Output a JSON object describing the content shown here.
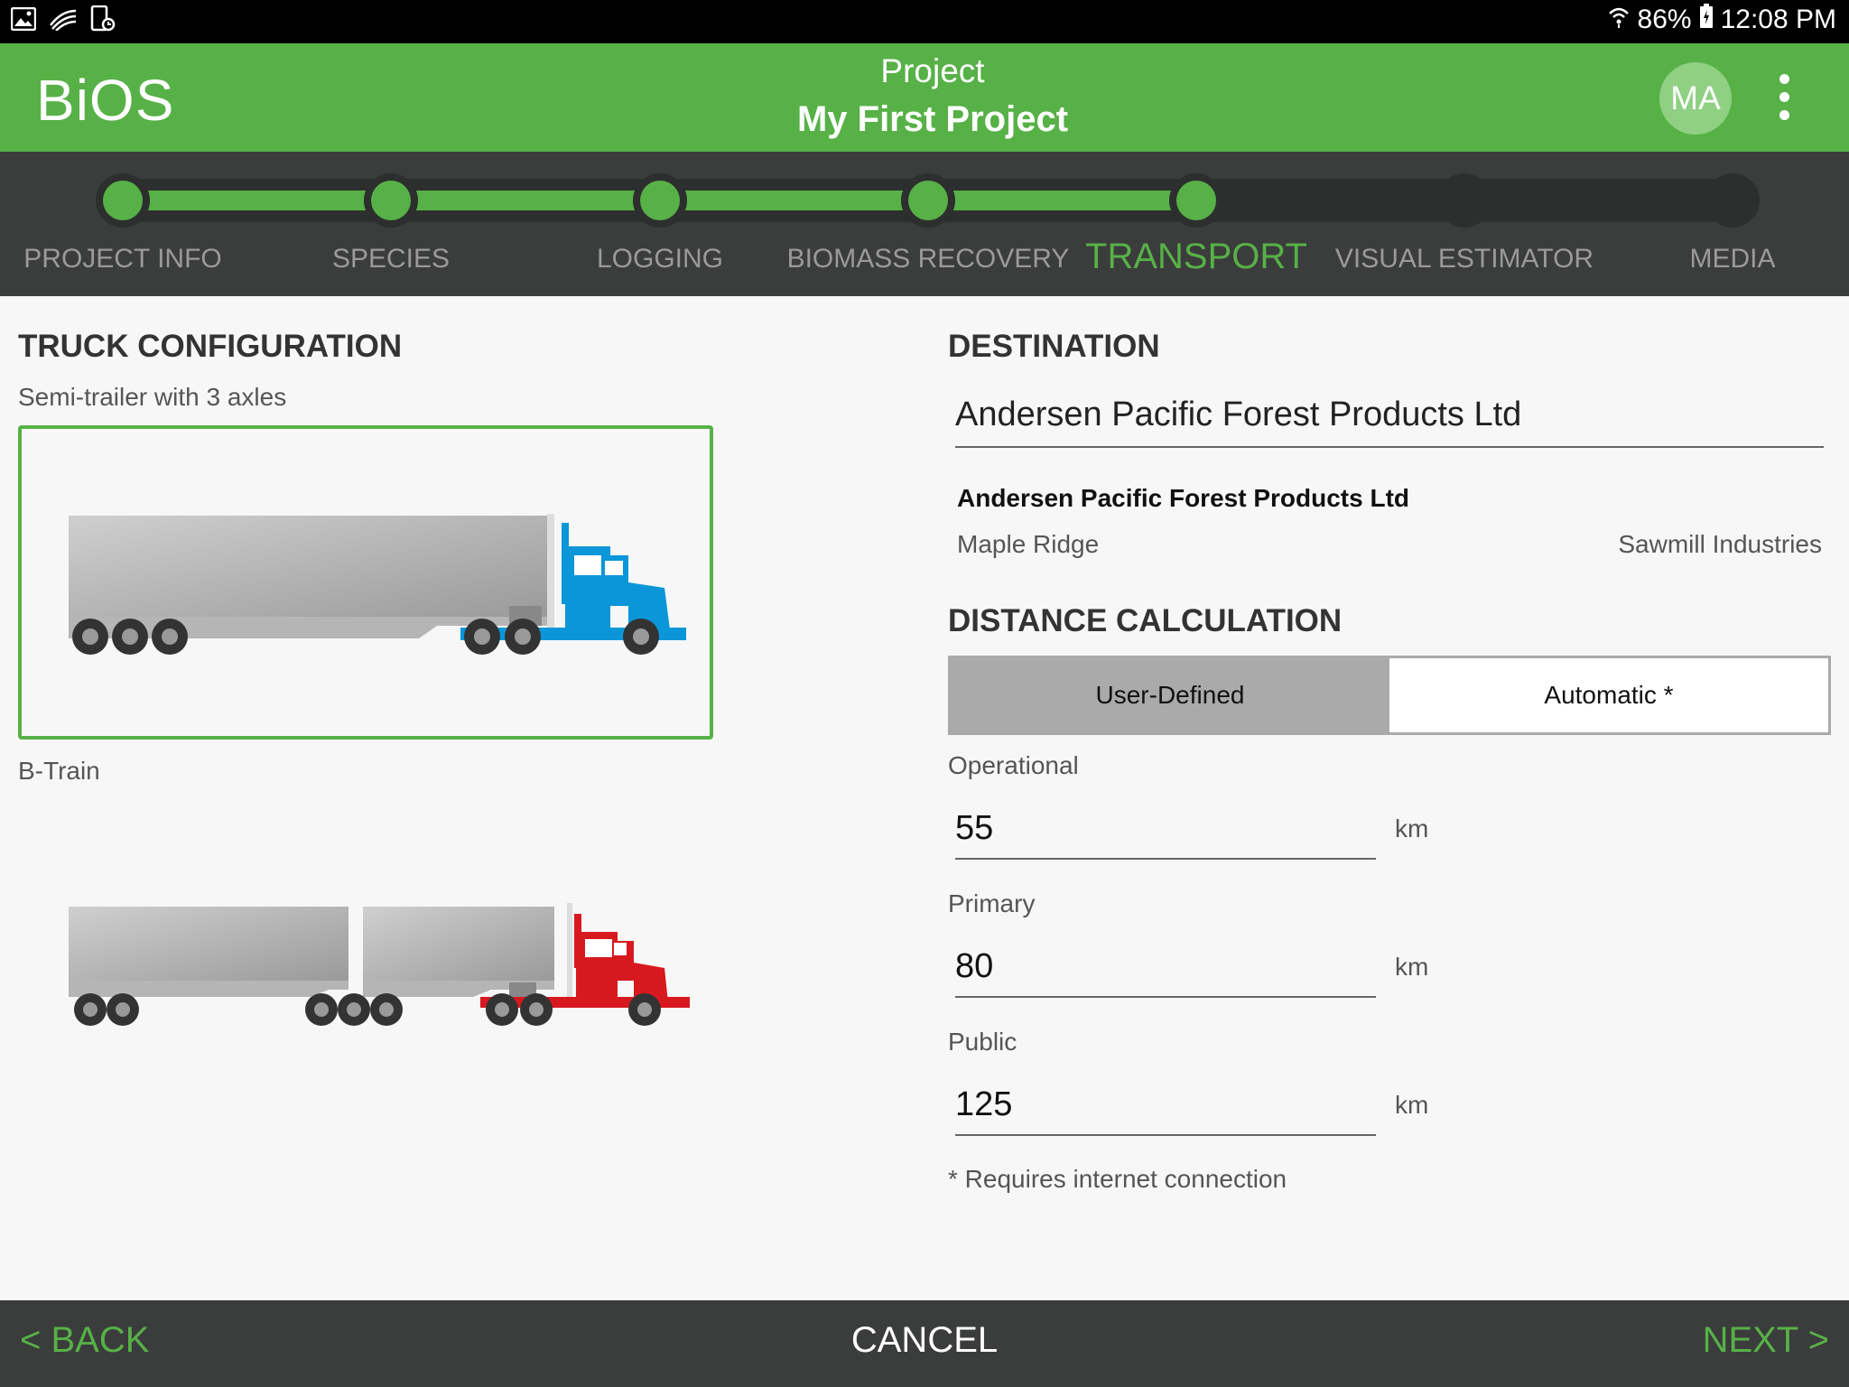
{
  "status_bar": {
    "battery": "86%",
    "time": "12:08 PM",
    "left_icons": [
      "gallery-icon",
      "swipe-icon",
      "screen-record-icon"
    ],
    "right_icons": [
      "wifi-icon",
      "battery-icon"
    ]
  },
  "app_bar": {
    "title": "BiOS",
    "project_label": "Project",
    "project_name": "My First Project",
    "avatar_initials": "MA",
    "menu_icon": "more-vert-icon"
  },
  "stepper": {
    "active_color": "#57b147",
    "inactive_color": "#2d2e2e",
    "steps": [
      {
        "label": "PROJECT INFO",
        "state": "done"
      },
      {
        "label": "SPECIES",
        "state": "done"
      },
      {
        "label": "LOGGING",
        "state": "done"
      },
      {
        "label": "BIOMASS RECOVERY",
        "state": "done"
      },
      {
        "label": "TRANSPORT",
        "state": "active"
      },
      {
        "label": "VISUAL ESTIMATOR",
        "state": "todo"
      },
      {
        "label": "MEDIA",
        "state": "todo"
      }
    ]
  },
  "truck_config": {
    "title": "TRUCK CONFIGURATION",
    "options": [
      {
        "label": "Semi-trailer with 3 axles",
        "cab_color": "#0a96d8",
        "selected": true
      },
      {
        "label": "B-Train",
        "cab_color": "#d7191f",
        "selected": false
      }
    ]
  },
  "destination": {
    "title": "DESTINATION",
    "input_value": "Andersen Pacific Forest Products Ltd",
    "result_name": "Andersen Pacific Forest Products Ltd",
    "result_location": "Maple Ridge",
    "result_type": "Sawmill Industries"
  },
  "distance": {
    "title": "DISTANCE CALCULATION",
    "mode_user": "User-Defined",
    "mode_auto": "Automatic *",
    "selected_mode": "User-Defined",
    "operational_label": "Operational",
    "operational_value": "55",
    "primary_label": "Primary",
    "primary_value": "80",
    "public_label": "Public",
    "public_value": "125",
    "unit": "km",
    "note": "* Requires internet connection"
  },
  "bottom_bar": {
    "back": "< BACK",
    "cancel": "CANCEL",
    "next": "NEXT >"
  },
  "colors": {
    "brand_green": "#57b147",
    "dark_bar": "#3b3c3c"
  }
}
